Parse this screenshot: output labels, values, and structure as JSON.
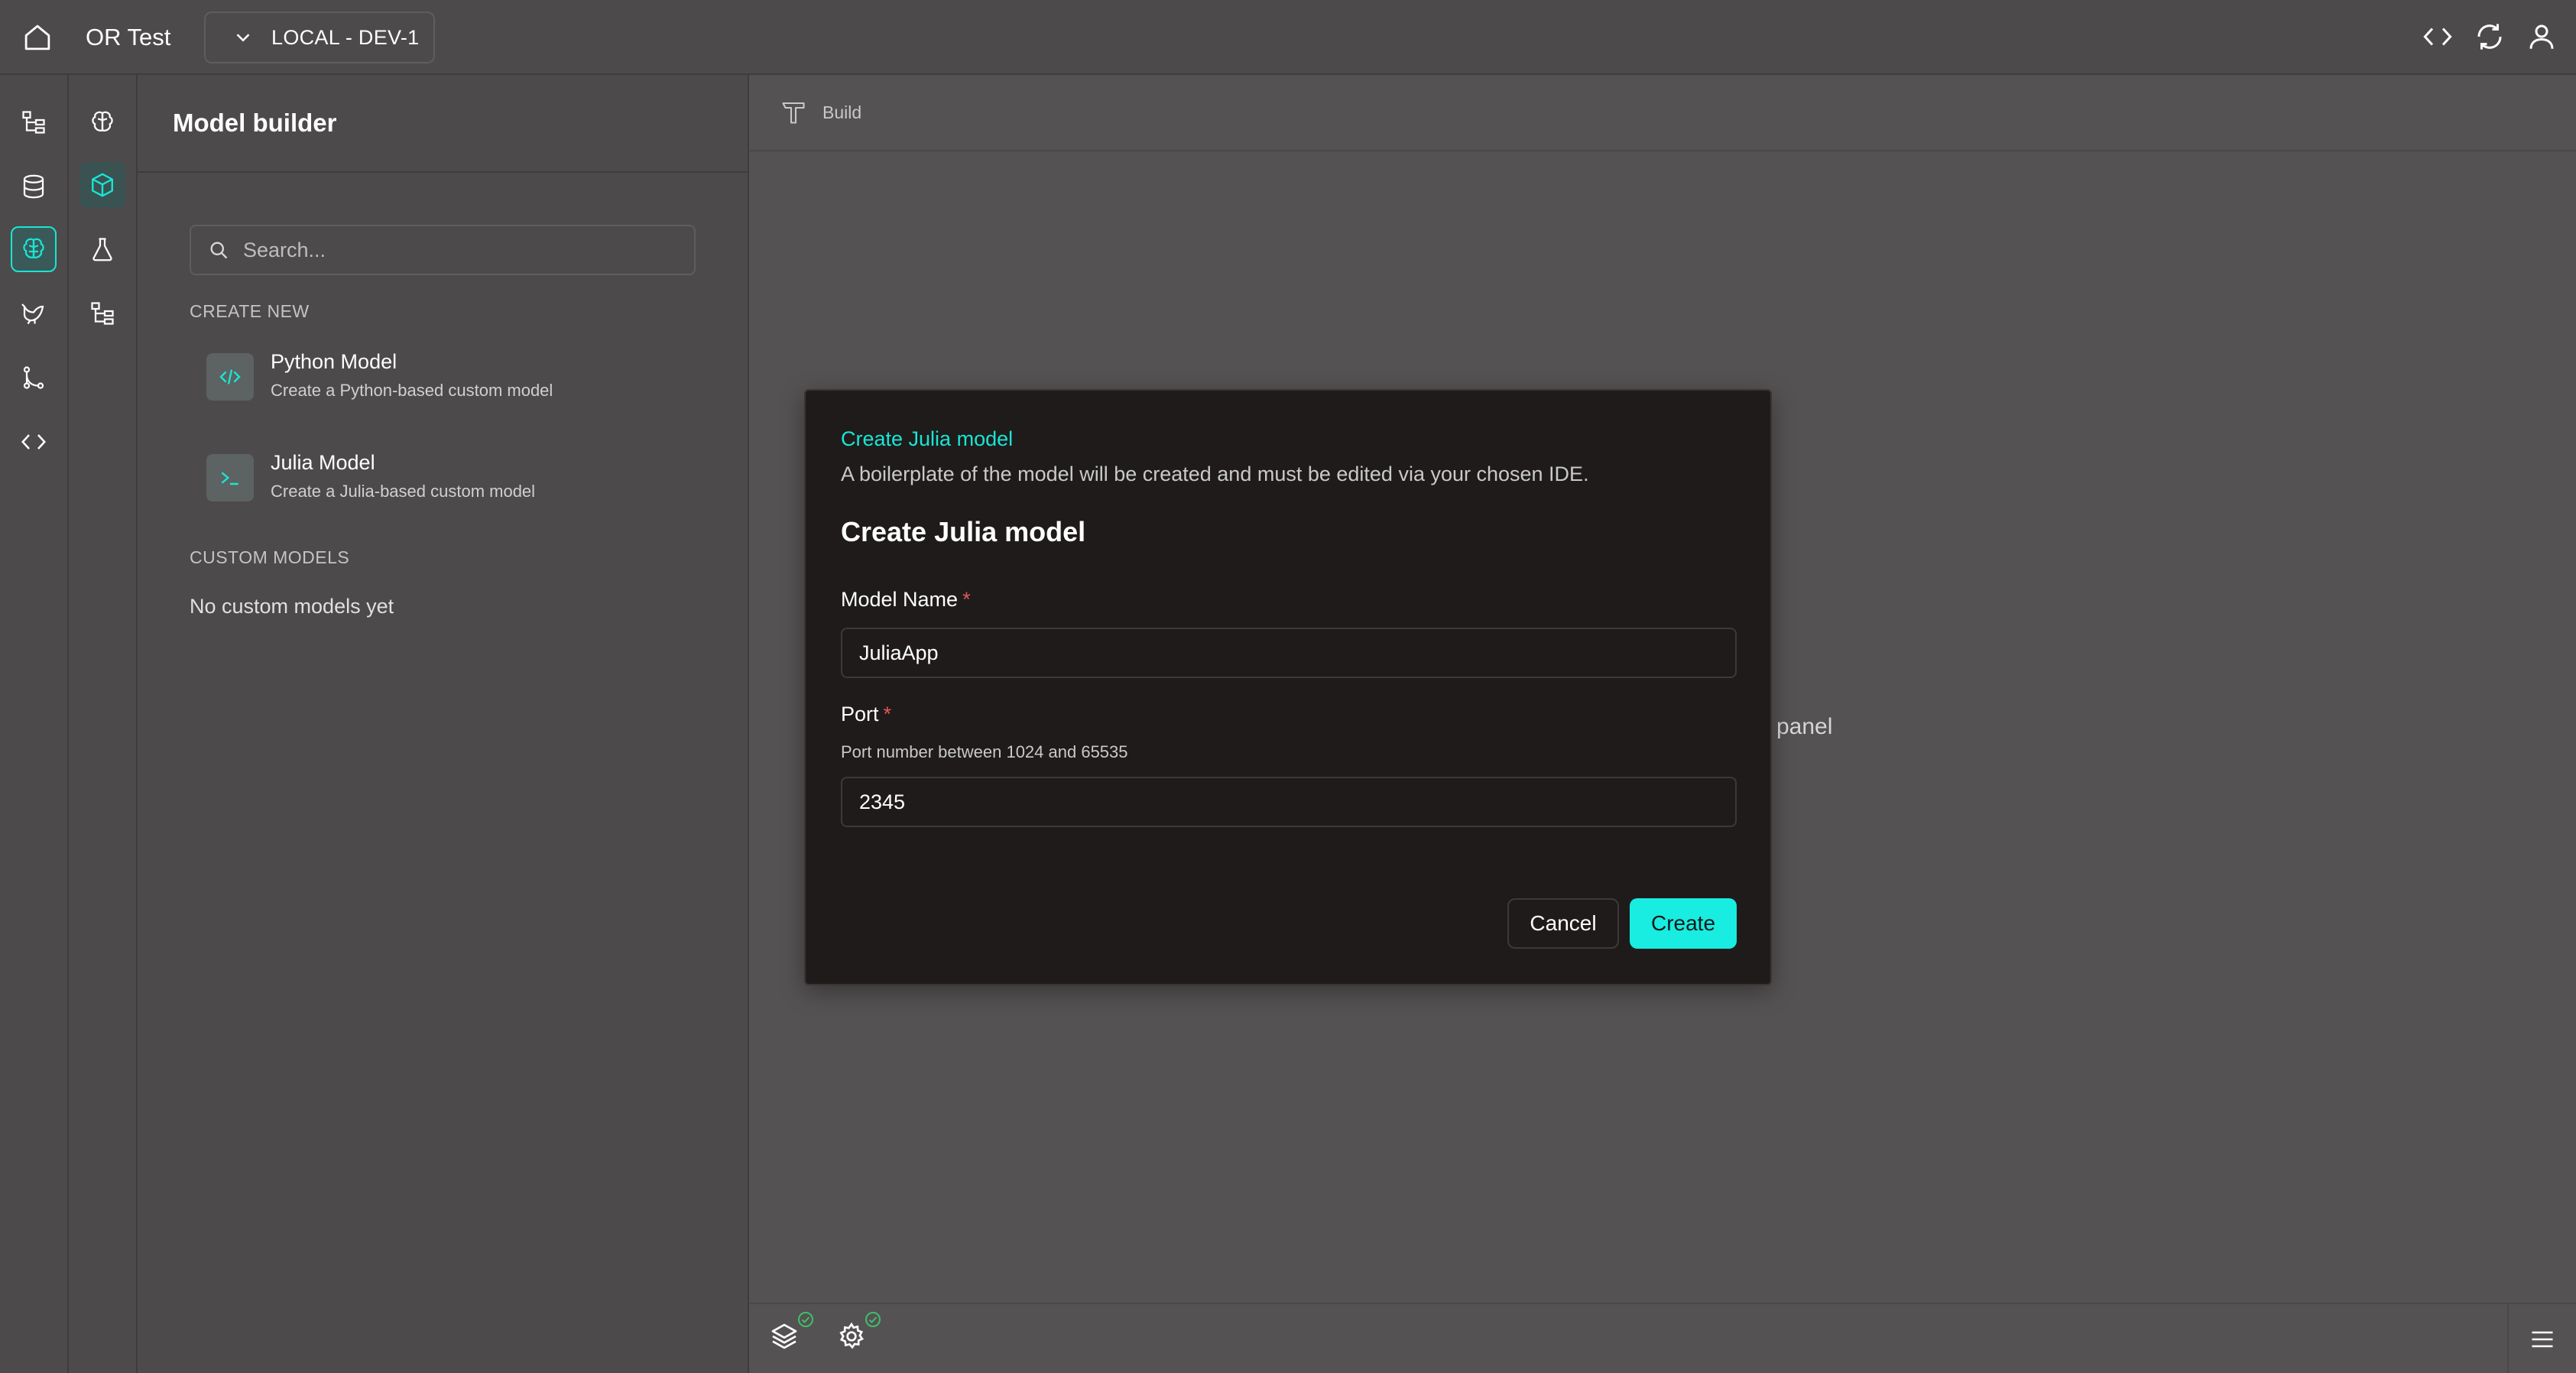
{
  "header": {
    "app_title": "OR Test",
    "environment": "LOCAL - DEV-1"
  },
  "icons": {
    "home": "home-icon",
    "env_chevron": "chevron-down-icon",
    "code": "code-icon",
    "refresh": "refresh-icon",
    "user": "user-icon"
  },
  "sidebar": {
    "title": "Model builder",
    "search_placeholder": "Search...",
    "create_new_label": "CREATE NEW",
    "items": [
      {
        "title": "Python Model",
        "subtitle": "Create a Python-based custom model"
      },
      {
        "title": "Julia Model",
        "subtitle": "Create a Julia-based custom model"
      }
    ],
    "custom_models_label": "CUSTOM MODELS",
    "empty_text": "No custom models yet"
  },
  "main": {
    "tab_label": "Build",
    "background_text": "panel"
  },
  "modal": {
    "kicker": "Create Julia model",
    "description": "A boilerplate of the model will be created and must be edited via your chosen IDE.",
    "title": "Create Julia model",
    "model_name_label": "Model Name",
    "model_name_value": "JuliaApp",
    "port_label": "Port",
    "port_help": "Port number between 1024 and 65535",
    "port_value": "2345",
    "required_mark": "*",
    "cancel_label": "Cancel",
    "create_label": "Create"
  },
  "colors": {
    "accent": "#19e6d4",
    "required": "#e25757",
    "status_ok": "#3fbf6a"
  }
}
